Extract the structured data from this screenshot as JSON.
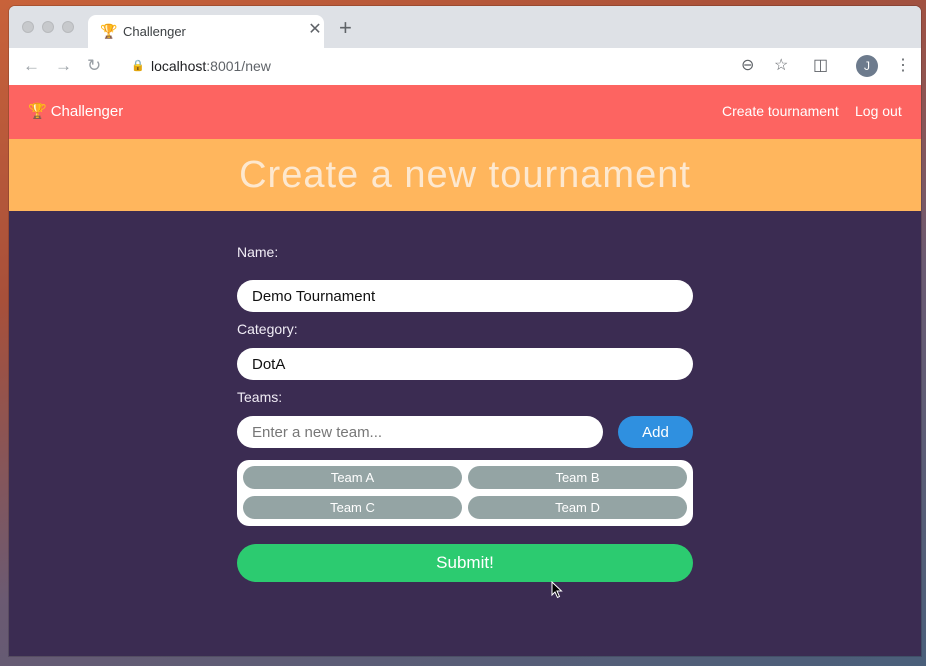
{
  "browser": {
    "tab_title": "Challenger",
    "new_tab_symbol": "+",
    "url_host": "localhost",
    "url_rest": ":8001/new",
    "profile_initial": "J"
  },
  "app": {
    "brand": "Challenger",
    "nav": {
      "create_tournament": "Create tournament",
      "log_out": "Log out"
    },
    "hero_title": "Create a new tournament"
  },
  "form": {
    "name_label": "Name:",
    "name_value": "Demo Tournament",
    "category_label": "Category:",
    "category_value": "DotA",
    "teams_label": "Teams:",
    "team_placeholder": "Enter a new team...",
    "add_label": "Add",
    "teams": [
      "Team A",
      "Team B",
      "Team C",
      "Team D"
    ],
    "submit_label": "Submit!"
  },
  "colors": {
    "navbar": "#fd6461",
    "hero": "#ffb65d",
    "page_bg": "#3b2c52",
    "add_button": "#2f90e0",
    "submit_button": "#2ccb70",
    "team_chip": "#94a4a4"
  },
  "icons": {
    "brand": "trophy-icon",
    "back": "arrow-left-icon",
    "forward": "arrow-right-icon",
    "reload": "reload-icon",
    "lock": "lock-icon",
    "zoom": "zoom-out-icon",
    "bookmark": "star-icon",
    "pocket": "pocket-icon",
    "menu": "kebab-menu-icon"
  }
}
